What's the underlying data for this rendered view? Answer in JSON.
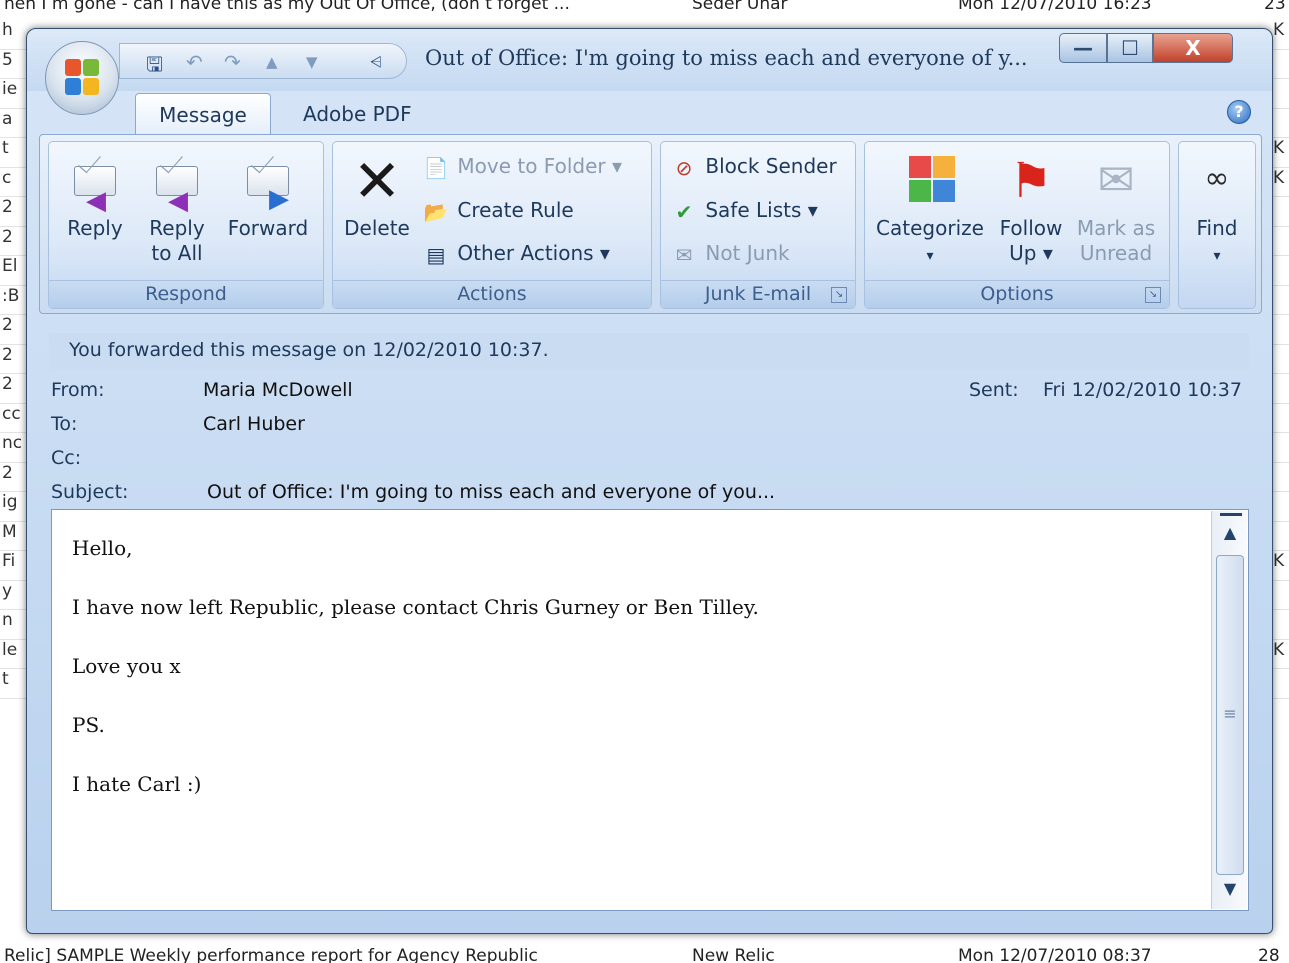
{
  "background": {
    "top_row": {
      "subject": "nen I m gone - can I have this as my Out Of Office, (don t forget ...",
      "from": "Seder Unar",
      "received": "Mon 12/07/2010 16:23",
      "size": "23"
    },
    "bottom_row": {
      "subject": "Relic] SAMPLE Weekly performance report for Agency Republic",
      "from": "New Relic",
      "received": "Mon 12/07/2010 08:37",
      "size": "28"
    },
    "left_letters": [
      "h",
      "5",
      "ie",
      "a",
      "t",
      "c",
      "2",
      "2",
      "El",
      ":B",
      "2",
      "2",
      "2",
      "cc",
      "nc",
      "2",
      "ig",
      "M",
      "Fi",
      "y",
      "n",
      "le",
      "t"
    ],
    "right_letters": [
      "K",
      "",
      "",
      "",
      "K",
      "K",
      "",
      "",
      "",
      "",
      "",
      "",
      "",
      "",
      "",
      "",
      "",
      "",
      "K",
      "",
      "",
      "K",
      ""
    ]
  },
  "window": {
    "title": "Out of Office: I'm going to miss each and everyone of y...",
    "controls": {
      "minimize": "—",
      "maximize": "☐",
      "close": "X"
    }
  },
  "qat": {
    "save": "🖫",
    "undo": "↶",
    "redo": "↷",
    "up": "▲",
    "down": "▼",
    "customize": "⩤"
  },
  "tabs": [
    {
      "label": "Message",
      "active": true
    },
    {
      "label": "Adobe PDF",
      "active": false
    }
  ],
  "help": "?",
  "ribbon": {
    "respond": {
      "label": "Respond",
      "reply": "Reply",
      "reply_all_1": "Reply",
      "reply_all_2": "to All",
      "forward": "Forward"
    },
    "actions": {
      "label": "Actions",
      "delete": "Delete",
      "move_to_folder": "Move to Folder ▾",
      "create_rule": "Create Rule",
      "other_actions": "Other Actions ▾"
    },
    "junk": {
      "label": "Junk E-mail",
      "block_sender": "Block Sender",
      "safe_lists": "Safe Lists ▾",
      "not_junk": "Not Junk"
    },
    "options": {
      "label": "Options",
      "categorize_1": "Categorize",
      "categorize_2": "▾",
      "follow_up_1": "Follow",
      "follow_up_2": "Up ▾",
      "mark_unread_1": "Mark as",
      "mark_unread_2": "Unread"
    },
    "find": {
      "label": "Find",
      "arrow": "▾"
    }
  },
  "message": {
    "info_bar": "You forwarded this message on 12/02/2010 10:37.",
    "from_label": "From:",
    "from": "Maria McDowell",
    "to_label": "To:",
    "to": "Carl Huber",
    "cc_label": "Cc:",
    "cc": "",
    "subject_label": "Subject:",
    "subject": "Out of Office: I'm going to miss each and everyone of you...",
    "sent_label": "Sent:",
    "sent": "Fri 12/02/2010 10:37",
    "body": [
      "Hello,",
      "I have now left Republic, please contact Chris Gurney or Ben Tilley.",
      "Love you x",
      "PS.",
      "I hate Carl :)"
    ]
  },
  "colors": {
    "window_frame": "#c4d9f1",
    "ribbon_group": "#dde9f8",
    "group_label": "#3c5f8e",
    "text": "#1e395b",
    "info_bar": "#c9dcf1"
  }
}
